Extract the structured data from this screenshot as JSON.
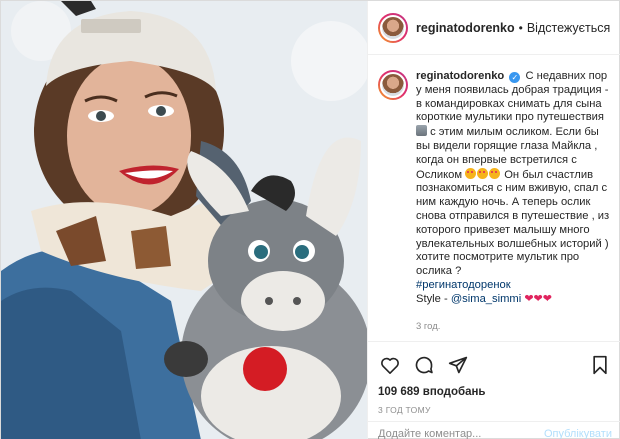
{
  "post": {
    "username": "reginatodorenko",
    "follow_label": "Відстежується",
    "separator": "•",
    "verified_icon": "verified-badge-icon"
  },
  "caption": {
    "text_1": "С недавних пор у меня появилась добрая традиция - в командировках снимать для сына короткие мультики про путешествия",
    "text_2": "с этим милым осликом. Если бы вы видели горящие глаза Майкла , когда он впервые встретился с Осликом",
    "text_3": "Он был счастлив познакомиться с ним вживую, спал с ним каждую ночь. А теперь ослик снова отправился в путешествие , из которого привезет малышу много увлекательных волшебных историй ) хотите посмотрите мультик про ослика ?",
    "hashtag": "#регинатодоренок",
    "style_label": "Style -",
    "mention": "@sima_simmi",
    "hearts": "❤❤❤",
    "timestamp": "3 год."
  },
  "actions": {
    "like_icon": "heart-icon",
    "comment_icon": "comment-icon",
    "share_icon": "share-icon",
    "save_icon": "bookmark-icon",
    "likes_text": "109 689 вподобань",
    "date_text": "3 ГОД ТОМУ"
  },
  "comment": {
    "placeholder": "Додайте коментар...",
    "publish_label": "Опублікувати"
  },
  "colors": {
    "link": "#00376b",
    "verified": "#3897f0",
    "heart": "#e0245e",
    "publish_disabled": "#b2dffc"
  }
}
